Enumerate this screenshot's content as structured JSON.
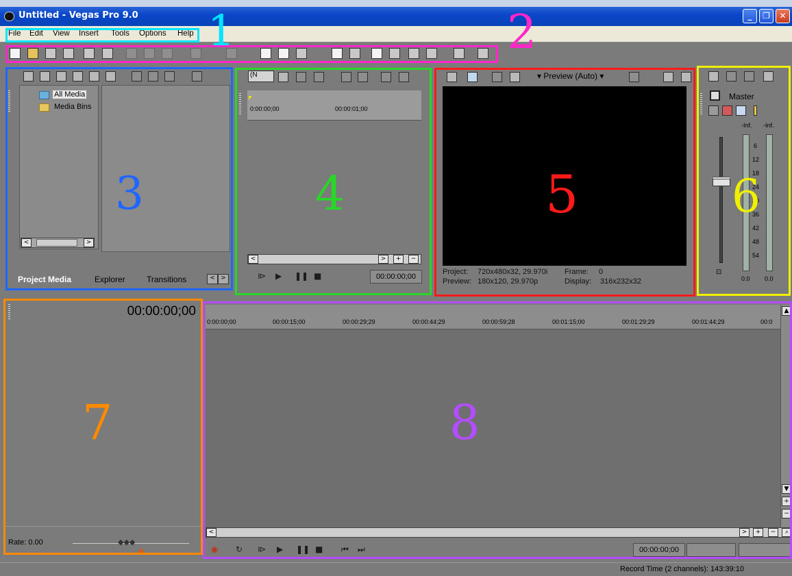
{
  "window": {
    "title": "Untitled - Vegas Pro 9.0",
    "minimize": "_",
    "restore": "❐",
    "close": "✕"
  },
  "menu": [
    "File",
    "Edit",
    "View",
    "Insert",
    "Tools",
    "Options",
    "Help"
  ],
  "project_media": {
    "tree": [
      "All Media",
      "Media Bins"
    ],
    "tabs": [
      "Project Media",
      "Explorer",
      "Transitions"
    ],
    "scroll_left": "<",
    "scroll_right": ">"
  },
  "trimmer": {
    "dropdown": "(N",
    "ruler": [
      "0:00:00;00",
      "00:00:01;00"
    ],
    "timecode": "00:00:00;00"
  },
  "preview": {
    "mode": "Preview (Auto)",
    "project_label": "Project:",
    "project_value": "720x480x32, 29.970i",
    "frame_label": "Frame:",
    "frame_value": "0",
    "preview_label": "Preview:",
    "preview_value": "180x120, 29.970p",
    "display_label": "Display:",
    "display_value": "316x232x32"
  },
  "mixer": {
    "master_label": "Master",
    "inf_left": "-Inf.",
    "inf_right": "-Inf.",
    "scale": [
      "6",
      "12",
      "18",
      "24",
      "30",
      "36",
      "42",
      "48",
      "54"
    ],
    "val_left": "0.0",
    "val_right": "0.0"
  },
  "track_header": {
    "timecode": "00:00:00;00",
    "rate": "Rate: 0.00"
  },
  "timeline": {
    "ruler": [
      "0:00:00;00",
      "00:00:15;00",
      "00:00:29;29",
      "00:00:44;29",
      "00:00:59;28",
      "00:01:15;00",
      "00:01:29;29",
      "00:01:44;29",
      "00:0"
    ],
    "timecode": "00:00:00;00"
  },
  "status": {
    "record_time": "Record Time (2 channels): 143:39:10"
  },
  "annotations": {
    "n1": "1",
    "n2": "2",
    "n3": "3",
    "n4": "4",
    "n5": "5",
    "n6": "6",
    "n7": "7",
    "n8": "8",
    "colors": {
      "1": "#00e5ff",
      "2": "#ff26c8",
      "3": "#1f66ff",
      "4": "#29d629",
      "5": "#ff1a1a",
      "6": "#f0f000",
      "7": "#ff8a00",
      "8": "#b44cff"
    }
  }
}
